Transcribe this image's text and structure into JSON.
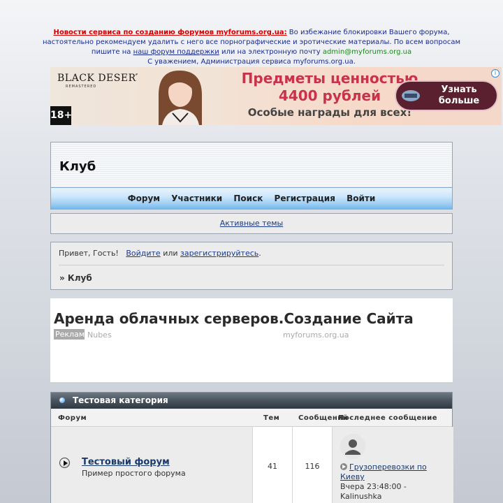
{
  "news": {
    "link_text": "Новости сервиса по созданию форумов myforums.org.ua:",
    "text1": " Во избежание блокировки Вашего форума, настоятельно рекомендуем удалить с него все порнографические и эротические материалы. По всем вопросам пишите на ",
    "support_link": "наш форум поддержки",
    "text2": " или на электронную почту ",
    "email": "admin@myforums.org.ua",
    "signature": "С уважением, Администрация сервиса myforums.org.ua."
  },
  "banner": {
    "logo": "BLACK DESERT",
    "logo_sub": "REMASTERED",
    "age": "18+",
    "headline1": "Предметы ценностью",
    "headline2": "4400 рублей",
    "headline3": "Особые награды для всех!",
    "cta": "Узнать больше",
    "info": "i"
  },
  "header": {
    "title": "Клуб",
    "nav": [
      "Форум",
      "Участники",
      "Поиск",
      "Регистрация",
      "Войти"
    ]
  },
  "active_topics": "Активные темы",
  "welcome": {
    "greeting": "Привет, Гость!",
    "login": "Войдите",
    "or": "или",
    "register": "зарегистрируйтесь",
    "period": ".",
    "breadcrumb": "» Клуб"
  },
  "ad": {
    "title": "Аренда облачных серверов.Создание Сайта",
    "tag": "Реклама",
    "source1": "Nubes",
    "source2": "myforums.org.ua"
  },
  "category": {
    "title": "Тестовая категория",
    "columns": {
      "forum": "Форум",
      "topics": "Тем",
      "posts": "Сообщений",
      "last": "Последнее сообщение"
    },
    "forums": [
      {
        "name": "Тестовый форум",
        "description": "Пример простого форума",
        "topics": "41",
        "posts": "116",
        "last_post": {
          "title": "Грузоперевозки по Киеву",
          "time": "Вчера 23:48:00 -",
          "author": "Kalinushka"
        }
      }
    ]
  }
}
